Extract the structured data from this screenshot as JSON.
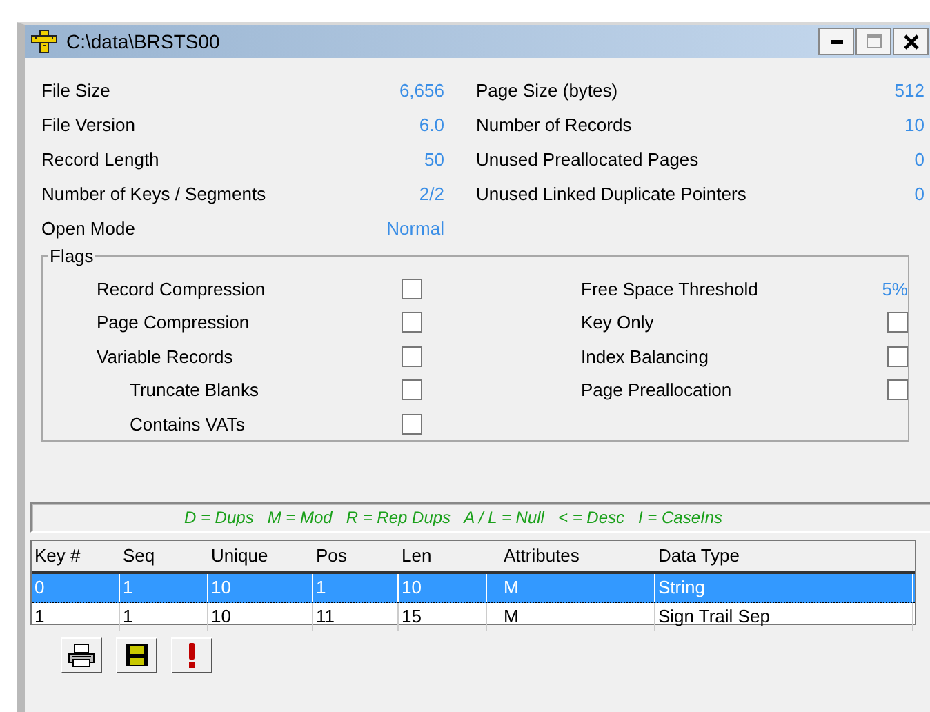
{
  "window": {
    "title": "C:\\data\\BRSTS00"
  },
  "info_left": [
    {
      "label": "File Size",
      "value": "6,656"
    },
    {
      "label": "File Version",
      "value": "6.0"
    },
    {
      "label": "Record Length",
      "value": "50"
    },
    {
      "label": "Number of Keys / Segments",
      "value": "2/2"
    },
    {
      "label": "Open Mode",
      "value": "Normal"
    }
  ],
  "info_right": [
    {
      "label": "Page Size (bytes)",
      "value": "512"
    },
    {
      "label": "Number of Records",
      "value": "10"
    },
    {
      "label": "Unused Preallocated Pages",
      "value": "0"
    },
    {
      "label": "Unused Linked Duplicate Pointers",
      "value": "0"
    }
  ],
  "flags": {
    "title": "Flags",
    "left": [
      {
        "kind": "checkbox",
        "label": "Record Compression",
        "checked": false
      },
      {
        "kind": "checkbox",
        "label": "Page Compression",
        "checked": false
      },
      {
        "kind": "checkbox",
        "label": "Variable Records",
        "checked": false,
        "children": [
          {
            "kind": "checkbox",
            "label": "Truncate Blanks",
            "checked": false
          },
          {
            "kind": "checkbox",
            "label": "Contains VATs",
            "checked": false
          }
        ]
      }
    ],
    "right": [
      {
        "kind": "value",
        "label": "Free Space Threshold",
        "value": "5%"
      },
      {
        "kind": "checkbox",
        "label": "Key Only",
        "checked": false
      },
      {
        "kind": "checkbox",
        "label": "Index Balancing",
        "checked": false
      },
      {
        "kind": "checkbox",
        "label": "Page Preallocation",
        "checked": false
      }
    ]
  },
  "legend": "D = Dups   M = Mod   R = Rep Dups   A / L = Null   < = Desc   I = CaseIns",
  "table": {
    "columns": [
      "Key #",
      "Seq",
      "Unique",
      "Pos",
      "Len",
      "Attributes",
      "Data Type"
    ],
    "rows": [
      {
        "selected": true,
        "cells": [
          "0",
          "1",
          "10",
          "1",
          "10",
          "M",
          "String"
        ]
      },
      {
        "selected": false,
        "cells": [
          "1",
          "1",
          "10",
          "11",
          "15",
          "M",
          "Sign Trail Sep"
        ]
      }
    ]
  }
}
